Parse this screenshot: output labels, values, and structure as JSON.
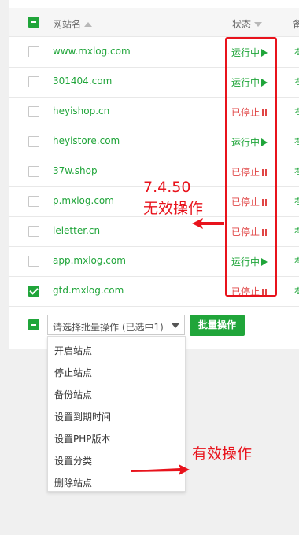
{
  "header": {
    "site_col": "网站名",
    "status_col": "状态",
    "cut_col": "备"
  },
  "rows": [
    {
      "site": "www.mxlog.com",
      "status": "运行中",
      "state": "running",
      "checked": false
    },
    {
      "site": "301404.com",
      "status": "运行中",
      "state": "running",
      "checked": false
    },
    {
      "site": "heyishop.cn",
      "status": "已停止",
      "state": "stopped",
      "checked": false
    },
    {
      "site": "heyistore.com",
      "status": "运行中",
      "state": "running",
      "checked": false
    },
    {
      "site": "37w.shop",
      "status": "已停止",
      "state": "stopped",
      "checked": false
    },
    {
      "site": "p.mxlog.com",
      "status": "已停止",
      "state": "stopped",
      "checked": false
    },
    {
      "site": "leletter.cn",
      "status": "已停止",
      "state": "stopped",
      "checked": false
    },
    {
      "site": "app.mxlog.com",
      "status": "运行中",
      "state": "running",
      "checked": false
    },
    {
      "site": "gtd.mxlog.com",
      "status": "已停止",
      "state": "stopped",
      "checked": true
    }
  ],
  "row_cut_text": "有",
  "batch": {
    "select_value": "请选择批量操作 (已选中1)",
    "button_label": "批量操作",
    "options": [
      "开启站点",
      "停止站点",
      "备份站点",
      "设置到期时间",
      "设置PHP版本",
      "设置分类",
      "删除站点"
    ]
  },
  "annotations": {
    "version": "7.4.50",
    "invalid": "无效操作",
    "valid": "有效操作"
  },
  "colors": {
    "accent": "#20a53a",
    "stopped": "#e04545",
    "annotation": "#e8131c"
  }
}
